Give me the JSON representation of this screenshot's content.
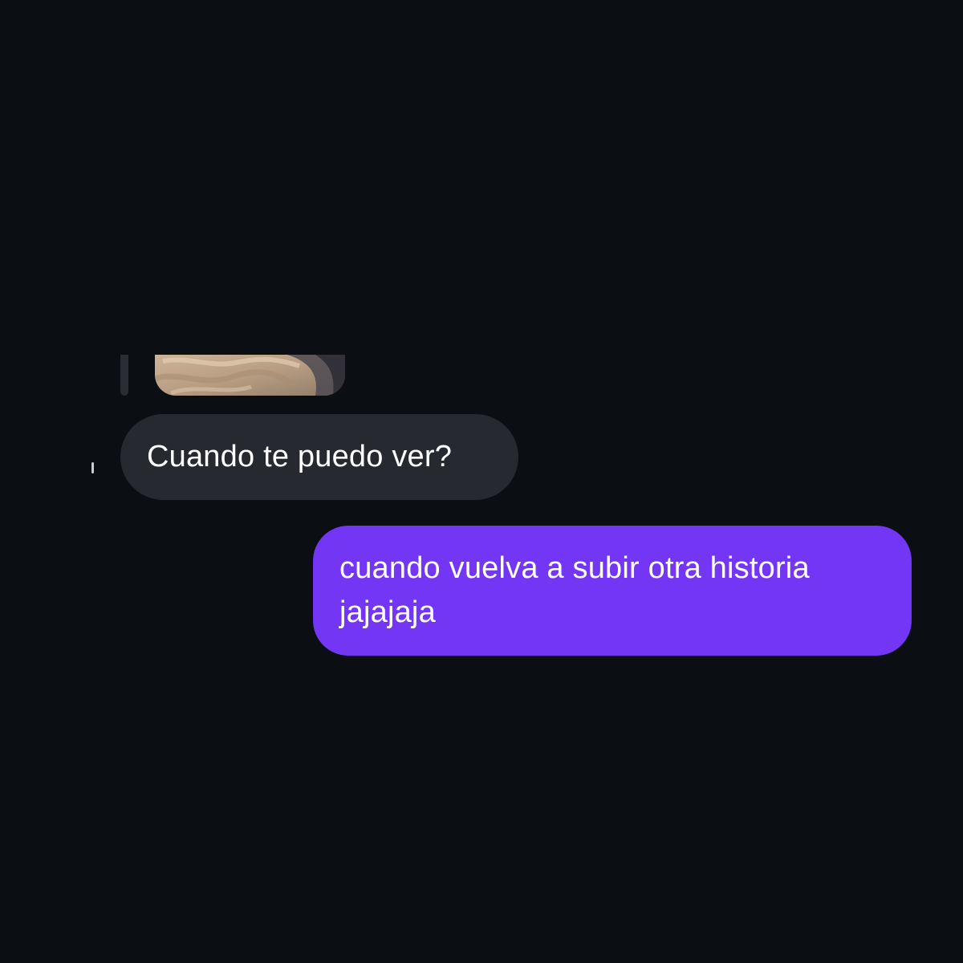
{
  "conversation": {
    "story_reply": {
      "thumbnail_icon": "story-photo-thumbnail"
    },
    "messages": [
      {
        "direction": "received",
        "text": "Cuando te puedo ver?"
      },
      {
        "direction": "sent",
        "text": "cuando vuelva a subir otra historia jajajaja"
      }
    ]
  },
  "colors": {
    "background": "#0b0e13",
    "received_bubble": "#26292f",
    "sent_bubble": "#7436f5",
    "text": "#ffffff"
  }
}
